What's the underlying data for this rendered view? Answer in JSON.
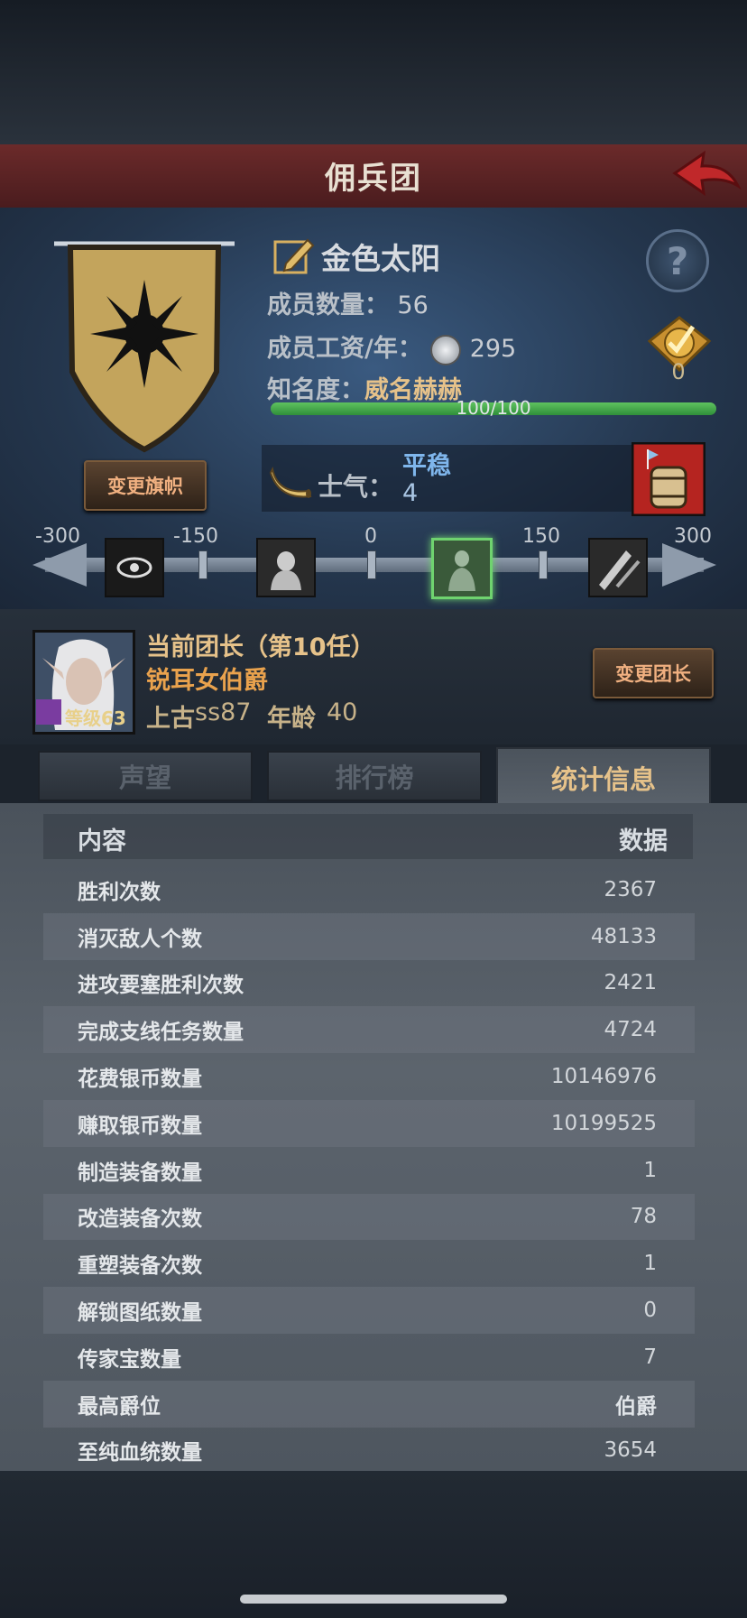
{
  "header": {
    "title": "佣兵团"
  },
  "guild": {
    "name": "金色太阳",
    "members_label": "成员数量：",
    "members_value": "56",
    "salary_label": "成员工资/年：",
    "salary_value": "295",
    "fame_label": "知名度：",
    "fame_value": "威名赫赫",
    "fame_progress_text": "100/100",
    "fame_progress_fraction": 1.0,
    "change_flag_label": "变更旗帜",
    "badge_count": "0"
  },
  "morale": {
    "label": "士气：",
    "state": "平稳",
    "value": "4",
    "ticks": [
      "-300",
      "-150",
      "0",
      "150",
      "300"
    ]
  },
  "leader": {
    "title": "当前团长（第10任）",
    "name": "锐耳女伯爵",
    "level": "等级63",
    "origin_label": "上古",
    "origin_value": "ss87",
    "age_label": "年龄",
    "age_value": "40",
    "change_label": "变更团长"
  },
  "tabs": [
    {
      "label": "声望"
    },
    {
      "label": "排行榜"
    },
    {
      "label": "统计信息"
    }
  ],
  "stats": {
    "col_content": "内容",
    "col_value": "数据",
    "rows": [
      {
        "label": "胜利次数",
        "value": "2367"
      },
      {
        "label": "消灭敌人个数",
        "value": "48133"
      },
      {
        "label": "进攻要塞胜利次数",
        "value": "2421"
      },
      {
        "label": "完成支线任务数量",
        "value": "4724"
      },
      {
        "label": "花费银币数量",
        "value": "10146976"
      },
      {
        "label": "赚取银币数量",
        "value": "10199525"
      },
      {
        "label": "制造装备数量",
        "value": "1"
      },
      {
        "label": "改造装备次数",
        "value": "78"
      },
      {
        "label": "重塑装备次数",
        "value": "1"
      },
      {
        "label": "解锁图纸数量",
        "value": "0"
      },
      {
        "label": "传家宝数量",
        "value": "7"
      },
      {
        "label": "最高爵位",
        "value": "伯爵"
      },
      {
        "label": "至纯血统数量",
        "value": "3654"
      }
    ]
  },
  "colors": {
    "accent_gold": "#e6c28a",
    "title_bar": "#6b2a2a",
    "morale_blue": "#7fb6ec",
    "progress_green": "#5fc25f"
  },
  "icons": [
    "back-arrow-icon",
    "edit-pencil-icon",
    "help-icon",
    "badge-check-icon",
    "silver-coin-icon",
    "horn-icon",
    "barrel-icon",
    "staff-icon"
  ]
}
